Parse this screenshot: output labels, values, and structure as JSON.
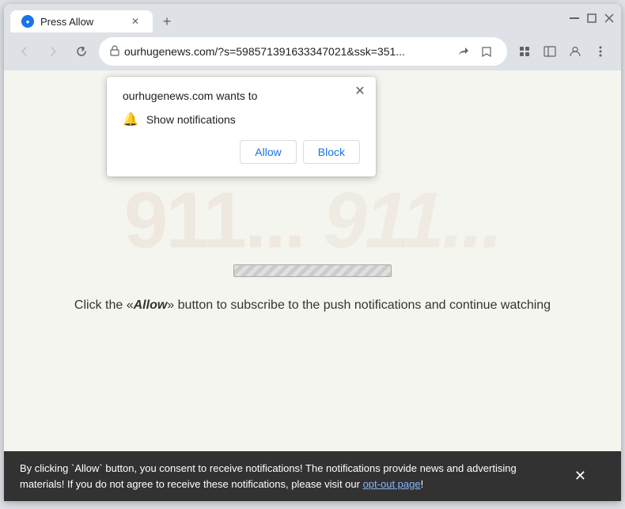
{
  "window": {
    "title": "Press Allow",
    "controls": {
      "minimize": "−",
      "maximize": "□",
      "close": "✕"
    }
  },
  "tab": {
    "favicon": "●",
    "title": "Press Allow",
    "close_icon": "✕"
  },
  "new_tab_icon": "+",
  "nav": {
    "back_icon": "←",
    "forward_icon": "→",
    "refresh_icon": "↻",
    "address": "ourhugenews.com/?s=598571391633347021&ssk=351...",
    "lock_icon": "🔒",
    "share_icon": "⎋",
    "bookmark_icon": "☆",
    "extension_icon": "🧩",
    "sidebar_icon": "▭",
    "account_icon": "👤",
    "menu_icon": "⋮"
  },
  "popup": {
    "title": "ourhugenews.com wants to",
    "close_icon": "✕",
    "item": {
      "bell_icon": "🔔",
      "text": "Show notifications"
    },
    "allow_button": "Allow",
    "block_button": "Block"
  },
  "page": {
    "watermark_text": "911...",
    "main_text_prefix": "Click the «",
    "main_text_bold": "Allow",
    "main_text_suffix": "» button to subscribe to the push notifications and continue watching"
  },
  "banner": {
    "text_before": "By clicking `Allow` button, you consent to receive notifications! The notifications provide news and advertising materials! If you do not agree to receive these notifications, please visit our ",
    "link_text": "opt-out page",
    "text_after": "!",
    "close_icon": "✕"
  }
}
